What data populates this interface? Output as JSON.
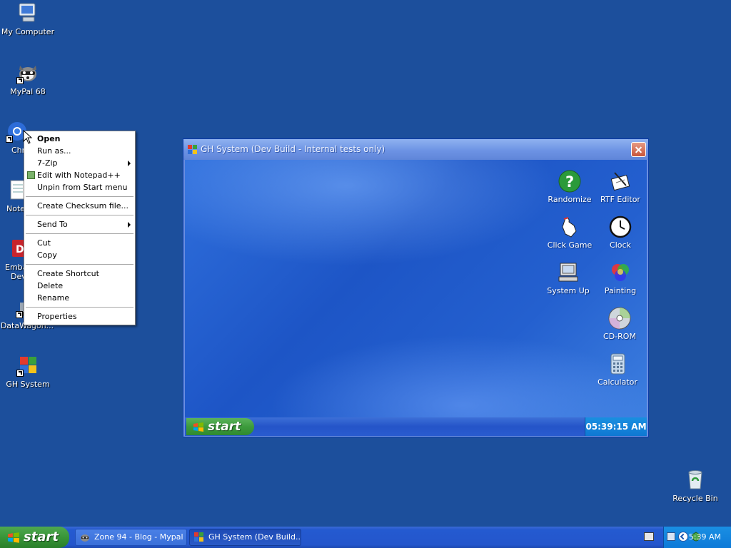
{
  "desktop": {
    "icons": [
      {
        "label": "My Computer",
        "icon": "my-computer-icon"
      },
      {
        "label": "MyPal 68",
        "icon": "mypal-raccoon-icon"
      },
      {
        "label": "Chr",
        "icon": "chrome-icon"
      },
      {
        "label": "Note",
        "icon": "notepad-icon"
      },
      {
        "label": "Emba",
        "label2": "Dev",
        "icon": "embarcadero-dev-icon"
      },
      {
        "label": "DataWagon...",
        "icon": "datawagon-icon"
      },
      {
        "label": "GH System",
        "icon": "gh-system-icon"
      },
      {
        "label": "Recycle Bin",
        "icon": "recycle-bin-icon"
      }
    ]
  },
  "context_menu": {
    "items": [
      "Open",
      "Run as...",
      "7-Zip",
      "Edit with Notepad++",
      "Unpin from Start menu",
      "Create Checksum file...",
      "Send To",
      "Cut",
      "Copy",
      "Create Shortcut",
      "Delete",
      "Rename",
      "Properties"
    ]
  },
  "window": {
    "title": "GH System (Dev Build - Internal tests only)",
    "apps": [
      {
        "label": "Randomize",
        "icon": "question-mark-icon"
      },
      {
        "label": "RTF Editor",
        "icon": "rtf-editor-icon"
      },
      {
        "label": "Click Game",
        "icon": "click-game-icon"
      },
      {
        "label": "Clock",
        "icon": "clock-icon"
      },
      {
        "label": "System Up",
        "icon": "computer-icon"
      },
      {
        "label": "Painting",
        "icon": "color-wheel-icon"
      },
      {
        "label": "CD-ROM",
        "icon": "cd-rom-icon"
      },
      {
        "label": "Calculator",
        "icon": "calculator-icon"
      }
    ],
    "taskbar": {
      "start_label": "start",
      "clock": "05:39:15 AM"
    }
  },
  "taskbar": {
    "start_label": "start",
    "tasks": [
      {
        "label": "Zone 94 - Blog - Mypal",
        "icon": "mypal-task-icon"
      },
      {
        "label": "GH System (Dev Build...",
        "icon": "gh-system-task-icon"
      }
    ],
    "clock": "5:39 AM"
  }
}
